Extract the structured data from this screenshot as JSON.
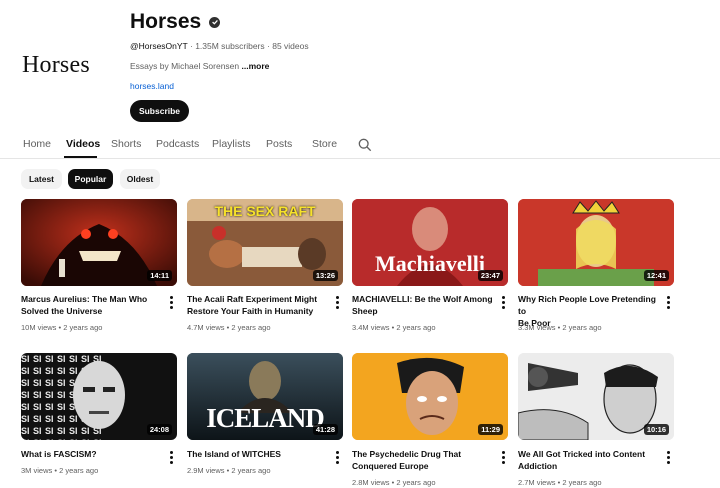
{
  "channel": {
    "logo_text": "Horses",
    "name": "Horses",
    "handle": "@HorsesOnYT",
    "subscribers": "1.35M subscribers",
    "videos_count": "85 videos",
    "description": "Essays by Michael Sorensen",
    "more_label": "...more",
    "link": "horses.land",
    "subscribe_label": "Subscribe"
  },
  "tabs": [
    {
      "label": "Home"
    },
    {
      "label": "Videos"
    },
    {
      "label": "Shorts"
    },
    {
      "label": "Podcasts"
    },
    {
      "label": "Playlists"
    },
    {
      "label": "Posts"
    },
    {
      "label": "Store"
    }
  ],
  "active_tab": "Videos",
  "chips": [
    {
      "label": "Latest"
    },
    {
      "label": "Popular"
    },
    {
      "label": "Oldest"
    }
  ],
  "active_chip": "Popular",
  "videos": [
    {
      "title_l1": "Marcus Aurelius: The Man Who",
      "title_l2": "Solved the Universe",
      "views": "10M views",
      "age": "2 years ago",
      "duration": "14:11",
      "thumb_text": ""
    },
    {
      "title_l1": "The Acali Raft Experiment Might",
      "title_l2": "Restore Your Faith in Humanity",
      "views": "4.7M views",
      "age": "2 years ago",
      "duration": "13:26",
      "thumb_text": "THE SEX RAFT"
    },
    {
      "title_l1": "MACHIAVELLI: Be the Wolf Among",
      "title_l2": "Sheep",
      "views": "3.4M views",
      "age": "2 years ago",
      "duration": "23:47",
      "thumb_text": "Machiavelli"
    },
    {
      "title_l1": "Why Rich People Love Pretending to",
      "title_l2": "Be Poor",
      "views": "3.3M views",
      "age": "2 years ago",
      "duration": "12:41",
      "thumb_text": ""
    },
    {
      "title_l1": "What is FASCISM?",
      "title_l2": "",
      "views": "3M views",
      "age": "2 years ago",
      "duration": "24:08",
      "thumb_text": "SI SI SI SI SI SI SI"
    },
    {
      "title_l1": "The Island of WITCHES",
      "title_l2": "",
      "views": "2.9M views",
      "age": "2 years ago",
      "duration": "41:28",
      "thumb_text": "ICELAND"
    },
    {
      "title_l1": "The Psychedelic Drug That",
      "title_l2": "Conquered Europe",
      "views": "2.8M views",
      "age": "2 years ago",
      "duration": "11:29",
      "thumb_text": ""
    },
    {
      "title_l1": "We All Got Tricked into Content",
      "title_l2": "Addiction",
      "views": "2.7M views",
      "age": "2 years ago",
      "duration": "10:16",
      "thumb_text": ""
    }
  ],
  "colors": {
    "accent_link": "#065fd4",
    "text_primary": "#0f0f0f",
    "text_secondary": "#606060",
    "chip_bg": "#f2f2f2"
  }
}
